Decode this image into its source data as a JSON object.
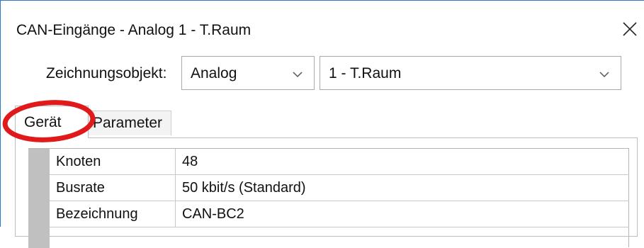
{
  "window": {
    "title": "CAN-Eingänge - Analog 1 - T.Raum",
    "close_icon": "close-icon"
  },
  "drawing_object": {
    "label": "Zeichnungsobjekt:",
    "type_value": "Analog",
    "object_value": "1 - T.Raum"
  },
  "tabs": [
    {
      "label": "Gerät",
      "active": true
    },
    {
      "label": "Parameter",
      "active": false
    }
  ],
  "properties": [
    {
      "key": "Knoten",
      "value": "48"
    },
    {
      "key": "Busrate",
      "value": "50 kbit/s (Standard)"
    },
    {
      "key": "Bezeichnung",
      "value": "CAN-BC2"
    }
  ],
  "colors": {
    "window_border": "#2b78c6",
    "highlight_circle": "#e0191b"
  }
}
